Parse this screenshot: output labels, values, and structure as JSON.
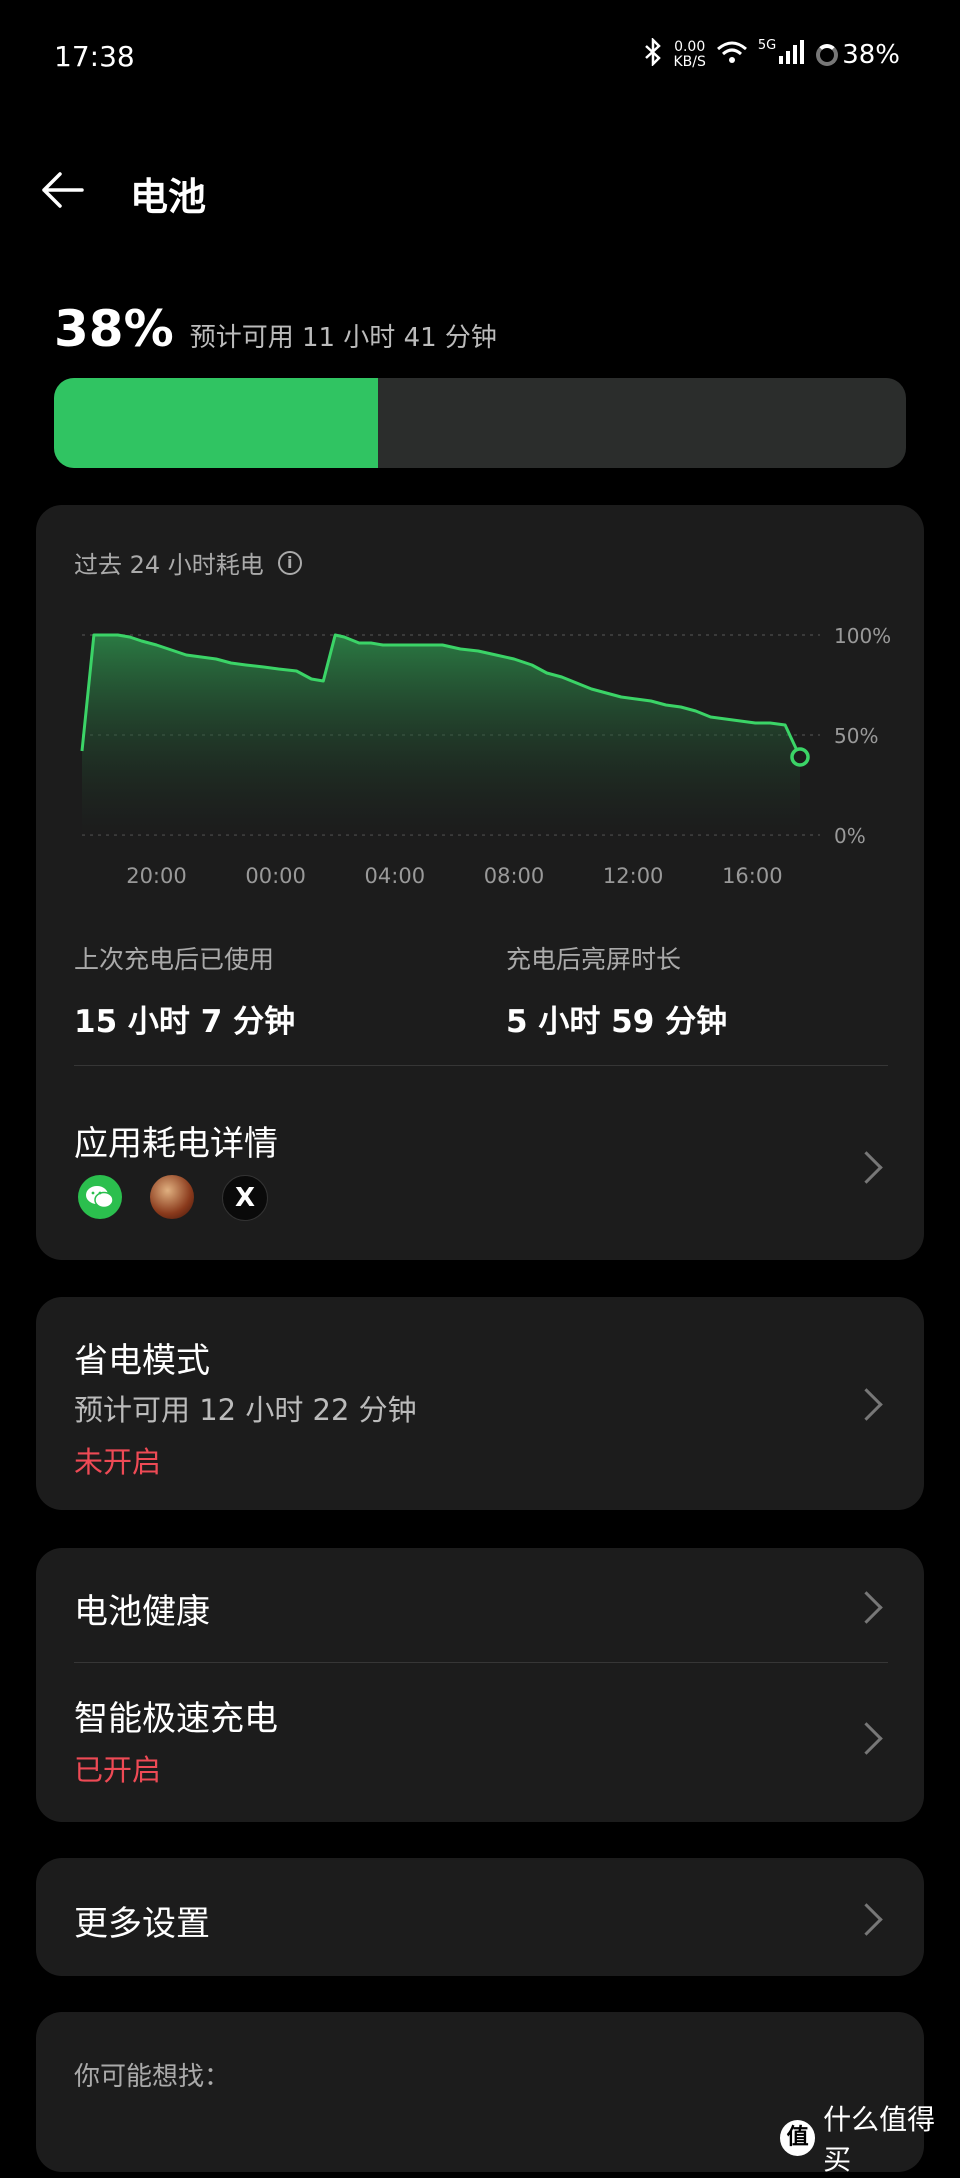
{
  "status_bar": {
    "time": "17:38",
    "net_speed_value": "0.00",
    "net_speed_unit": "KB/S",
    "network": "5G",
    "battery": "38%"
  },
  "header": {
    "title": "电池"
  },
  "battery": {
    "percent": "38%",
    "level_fraction": 0.38,
    "estimate": "预计可用 11 小时 41 分钟"
  },
  "chart_card": {
    "title": "过去 24 小时耗电",
    "info_glyph": "i",
    "used_label": "上次充电后已使用",
    "used_value": "15 小时 7 分钟",
    "screen_label": "充电后亮屏时长",
    "screen_value": "5 小时 59 分钟",
    "app_usage_title": "应用耗电详情",
    "apps": [
      "wechat-icon",
      "game-avatar-icon",
      "x-icon"
    ],
    "x_glyph": "X"
  },
  "chart_data": {
    "type": "area",
    "x_ticks": [
      "20:00",
      "00:00",
      "04:00",
      "08:00",
      "12:00",
      "16:00"
    ],
    "y_ticks": [
      "100%",
      "50%",
      "0%"
    ],
    "ylim": [
      0,
      100
    ],
    "xlim": [
      17.5,
      41.6
    ],
    "x": [
      17.5,
      17.9,
      18.7,
      19.1,
      19.5,
      20.0,
      20.6,
      21.0,
      21.5,
      22.0,
      22.5,
      23.0,
      23.6,
      24.1,
      24.7,
      25.2,
      25.6,
      26.0,
      26.3,
      26.8,
      27.2,
      27.6,
      28.0,
      28.5,
      29.0,
      29.6,
      30.2,
      30.8,
      31.4,
      32.0,
      32.6,
      33.1,
      33.6,
      34.1,
      34.6,
      35.1,
      35.6,
      36.1,
      36.6,
      37.1,
      37.6,
      38.1,
      38.6,
      39.1,
      39.6,
      40.1,
      40.6,
      41.1,
      41.6
    ],
    "y": [
      42,
      100,
      100,
      99,
      97,
      95,
      92,
      90,
      89,
      88,
      86,
      85,
      84,
      83,
      82,
      78,
      77,
      100,
      99,
      96,
      96,
      95,
      95,
      95,
      95,
      95,
      93,
      92,
      90,
      88,
      85,
      81,
      79,
      76,
      73,
      71,
      69,
      68,
      67,
      65,
      64,
      62,
      59,
      58,
      57,
      56,
      56,
      55,
      39
    ],
    "color": "#3bd467",
    "grid": true
  },
  "power_saver": {
    "title": "省电模式",
    "estimate": "预计可用 12 小时 22 分钟",
    "status": "未开启"
  },
  "battery_health": {
    "title": "电池健康"
  },
  "fast_charge": {
    "title": "智能极速充电",
    "status": "已开启"
  },
  "more_settings": {
    "title": "更多设置"
  },
  "suggestions": {
    "label": "你可能想找："
  },
  "watermark": {
    "badge": "值",
    "text": "什么值得买"
  },
  "colors": {
    "accent_green": "#30c462",
    "status_red": "#ee4a55",
    "card_bg": "#1c1c1c"
  }
}
